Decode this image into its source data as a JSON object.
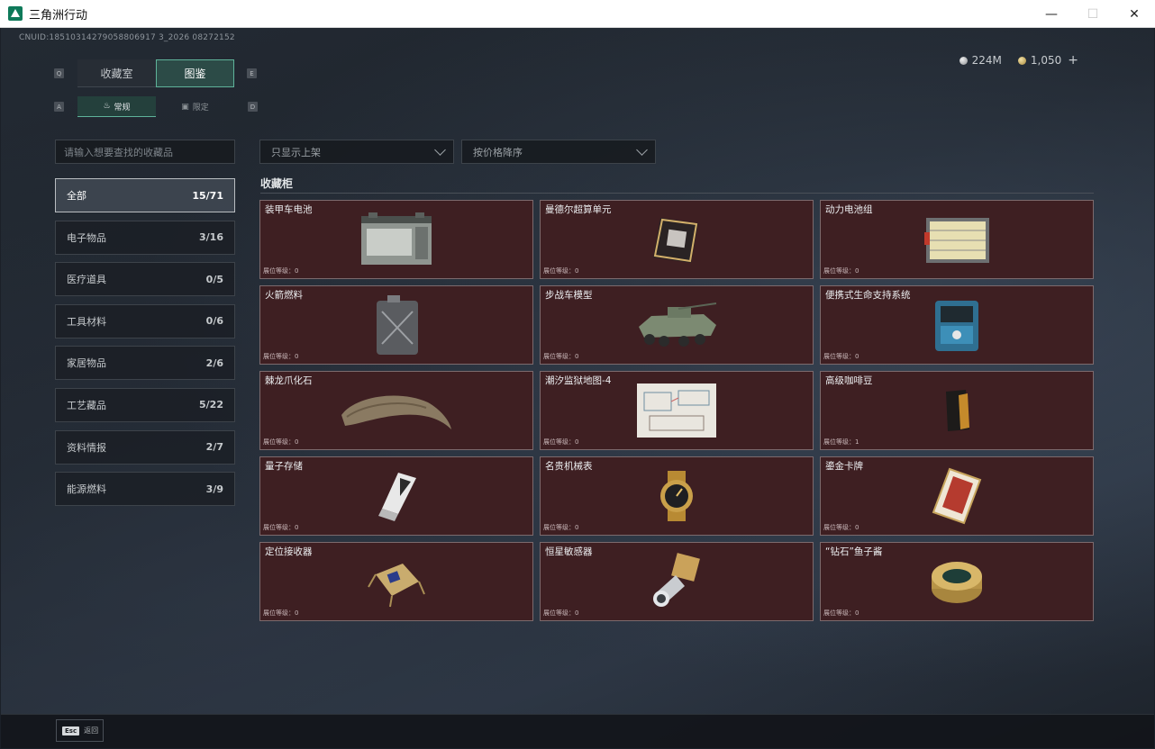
{
  "window": {
    "title": "三角洲行动",
    "minimize": "—",
    "maximize": "☐",
    "close": "✕"
  },
  "uid": "CNUID:18510314279058806917 3_2026 08272152",
  "currency": [
    {
      "icon": "silver-coin-icon",
      "value": "224M"
    },
    {
      "icon": "gold-coin-icon",
      "value": "1,050"
    }
  ],
  "currency_plus": "+",
  "tabs": {
    "left_key": "Q",
    "right_key": "E",
    "items": [
      {
        "label": "收藏室",
        "active": false
      },
      {
        "label": "图鉴",
        "active": true
      }
    ]
  },
  "subtabs": {
    "left_key": "A",
    "right_key": "D",
    "items": [
      {
        "label": "常规",
        "icon": "flame-icon",
        "active": true
      },
      {
        "label": "限定",
        "icon": "badge-icon",
        "active": false
      }
    ]
  },
  "search": {
    "placeholder": "请输入想要查找的收藏品"
  },
  "categories": [
    {
      "label": "全部",
      "count": "15/71",
      "active": true
    },
    {
      "label": "电子物品",
      "count": "3/16"
    },
    {
      "label": "医疗道具",
      "count": "0/5"
    },
    {
      "label": "工具材料",
      "count": "0/6"
    },
    {
      "label": "家居物品",
      "count": "2/6"
    },
    {
      "label": "工艺藏品",
      "count": "5/22"
    },
    {
      "label": "资料情报",
      "count": "2/7"
    },
    {
      "label": "能源燃料",
      "count": "3/9"
    }
  ],
  "filters": {
    "shelf": "只显示上架",
    "sort": "按价格降序"
  },
  "section_title": "收藏柜",
  "items": [
    {
      "name": "装甲车电池",
      "level": "展位等级：0",
      "art": "battery"
    },
    {
      "name": "曼德尔超算单元",
      "level": "展位等级：0",
      "art": "chip"
    },
    {
      "name": "动力电池组",
      "level": "展位等级：0",
      "art": "powerpack"
    },
    {
      "name": "火箭燃料",
      "level": "展位等级：0",
      "art": "fuel"
    },
    {
      "name": "步战车模型",
      "level": "展位等级：0",
      "art": "vehicle"
    },
    {
      "name": "便携式生命支持系统",
      "level": "展位等级：0",
      "art": "lifesupport"
    },
    {
      "name": "棘龙爪化石",
      "level": "展位等级：0",
      "art": "claw"
    },
    {
      "name": "潮汐监狱地图-4",
      "level": "展位等级：0",
      "art": "map"
    },
    {
      "name": "高级咖啡豆",
      "level": "展位等级：1",
      "art": "coffee"
    },
    {
      "name": "量子存储",
      "level": "展位等级：0",
      "art": "usb"
    },
    {
      "name": "名贵机械表",
      "level": "展位等级：0",
      "art": "watch"
    },
    {
      "name": "鎏金卡牌",
      "level": "展位等级：0",
      "art": "card"
    },
    {
      "name": "定位接收器",
      "level": "展位等级：0",
      "art": "receiver"
    },
    {
      "name": "恒星敏感器",
      "level": "展位等级：0",
      "art": "sensor"
    },
    {
      "name": "“钻石”鱼子酱",
      "level": "展位等级：0",
      "art": "caviar"
    }
  ],
  "bottom": {
    "key": "Esc",
    "label": "返回"
  }
}
